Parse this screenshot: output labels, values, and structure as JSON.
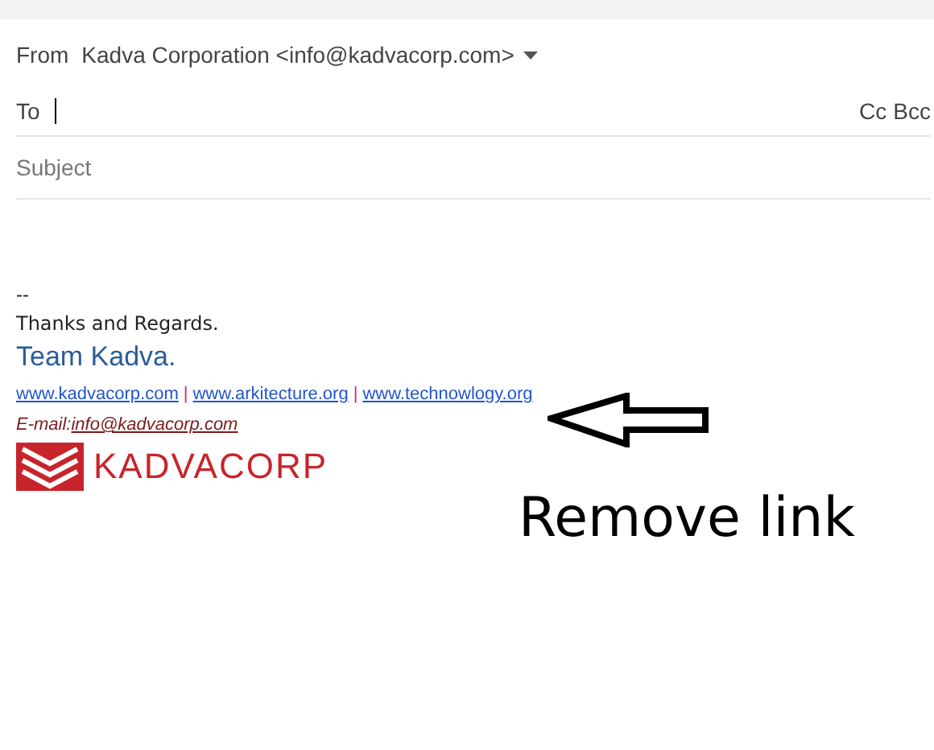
{
  "compose": {
    "from_label": "From",
    "from_value": "Kadva Corporation <info@kadvacorp.com>",
    "to_label": "To",
    "cc": "Cc",
    "bcc": "Bcc",
    "subject_placeholder": "Subject"
  },
  "signature": {
    "separator": "--",
    "closing": "Thanks and Regards.",
    "team": "Team Kadva.",
    "links": [
      "www.kadvacorp.com",
      "www.arkitecture.org",
      "www.technowlogy.org"
    ],
    "link_separators": [
      "|",
      "|"
    ],
    "email_label": "E-mail:",
    "email": "info@kadvacorp.com",
    "logo_text": "KADVACORP"
  },
  "annotation": {
    "text": "Remove link"
  }
}
